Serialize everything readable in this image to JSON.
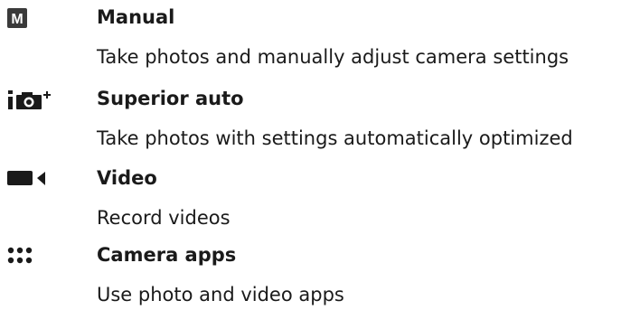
{
  "modes": [
    {
      "icon": "manual-mode-icon",
      "icon_glyph": "M",
      "name": "Manual",
      "description": "Take photos and manually adjust camera settings"
    },
    {
      "icon": "superior-auto-icon",
      "name": "Superior auto",
      "description": "Take photos with settings automatically optimized"
    },
    {
      "icon": "video-camera-icon",
      "name": "Video",
      "description": "Record videos"
    },
    {
      "icon": "camera-apps-grid-icon",
      "name": "Camera apps",
      "description": "Use photo and video apps"
    }
  ],
  "colors": {
    "text": "#1a1a1a",
    "icon": "#1a1a1a",
    "manual_icon_bg": "#3a3a3a",
    "manual_icon_fg": "#ffffff"
  }
}
